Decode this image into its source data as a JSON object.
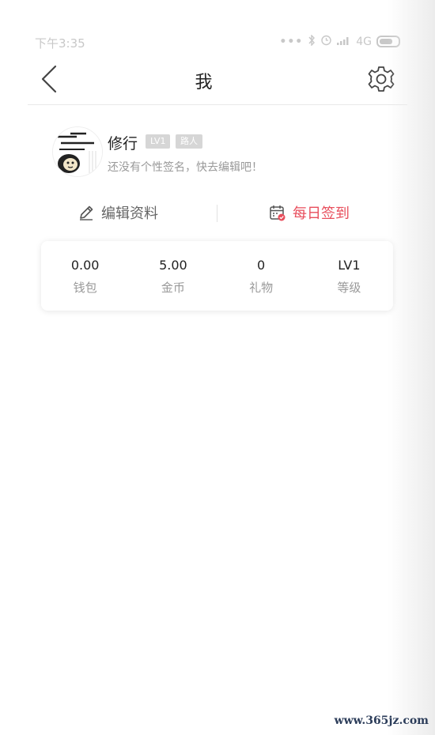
{
  "status_bar": {
    "time": "下午3:35",
    "network": "4G"
  },
  "header": {
    "title": "我"
  },
  "profile": {
    "username": "修行",
    "level_badge": "LV1",
    "title_badge": "路人",
    "signature": "还没有个性签名，快去编辑吧！"
  },
  "actions": {
    "edit_label": "编辑资料",
    "checkin_label": "每日签到",
    "checkin_color": "#e84e5c"
  },
  "stats": [
    {
      "value": "0.00",
      "label": "钱包"
    },
    {
      "value": "5.00",
      "label": "金币"
    },
    {
      "value": "0",
      "label": "礼物"
    },
    {
      "value": "LV1",
      "label": "等级"
    }
  ],
  "watermark": "www.365jz.com"
}
